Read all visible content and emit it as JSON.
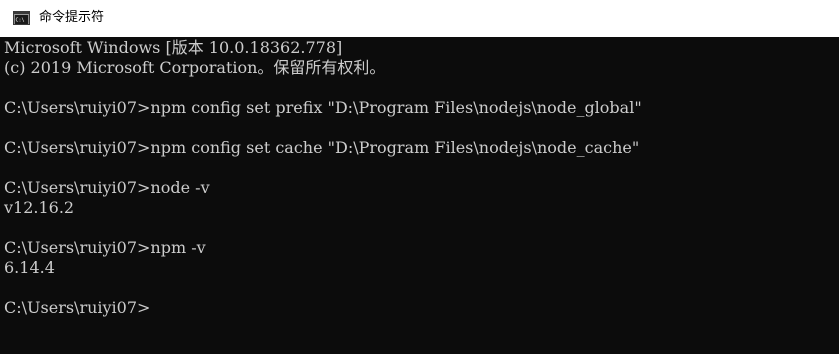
{
  "window": {
    "title": "命令提示符",
    "icon": "cmd-console-icon"
  },
  "console": {
    "lines": [
      "Microsoft Windows [版本 10.0.18362.778]",
      "(c) 2019 Microsoft Corporation。保留所有权利。",
      "C:\\Users\\ruiyi07>npm config set prefix \"D:\\Program Files\\nodejs\\node_global\"",
      "C:\\Users\\ruiyi07>npm config set cache \"D:\\Program Files\\nodejs\\node_cache\"",
      "C:\\Users\\ruiyi07>node -v",
      "v12.16.2",
      "C:\\Users\\ruiyi07>npm -v",
      "6.14.4",
      "C:\\Users\\ruiyi07>"
    ]
  },
  "colors": {
    "console_background": "#0c0c0c",
    "console_text": "#cccccc",
    "titlebar_background": "#ffffff"
  }
}
